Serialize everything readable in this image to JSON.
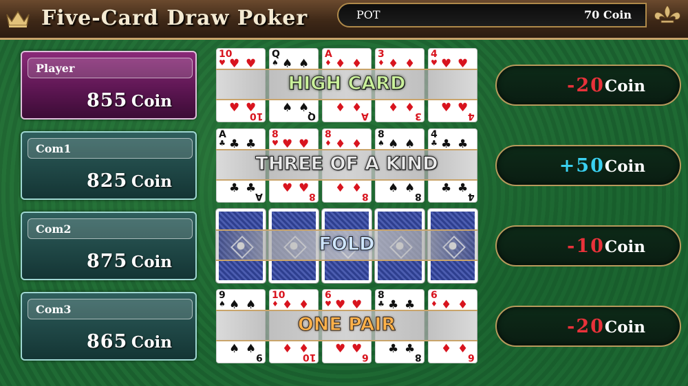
{
  "header": {
    "title": "Five-Card Draw Poker",
    "pot_label": "POT",
    "pot_value": "70 Coin"
  },
  "players": [
    {
      "name": "Player",
      "coins": "855",
      "unit": "Coin"
    },
    {
      "name": "Com1",
      "coins": "825",
      "unit": "Coin"
    },
    {
      "name": "Com2",
      "coins": "875",
      "unit": "Coin"
    },
    {
      "name": "Com3",
      "coins": "865",
      "unit": "Coin"
    }
  ],
  "hands": [
    {
      "result_label": "HIGH CARD",
      "cards": [
        {
          "rank": "10",
          "suit": "♥",
          "color": "red"
        },
        {
          "rank": "Q",
          "suit": "♠",
          "color": "black"
        },
        {
          "rank": "A",
          "suit": "♦",
          "color": "red"
        },
        {
          "rank": "3",
          "suit": "♦",
          "color": "red"
        },
        {
          "rank": "4",
          "suit": "♥",
          "color": "red"
        }
      ]
    },
    {
      "result_label": "THREE OF A KIND",
      "cards": [
        {
          "rank": "A",
          "suit": "♣",
          "color": "black"
        },
        {
          "rank": "8",
          "suit": "♥",
          "color": "red"
        },
        {
          "rank": "8",
          "suit": "♦",
          "color": "red"
        },
        {
          "rank": "8",
          "suit": "♠",
          "color": "black"
        },
        {
          "rank": "4",
          "suit": "♣",
          "color": "black"
        }
      ]
    },
    {
      "result_label": "FOLD",
      "cards": []
    },
    {
      "result_label": "ONE PAIR",
      "cards": [
        {
          "rank": "9",
          "suit": "♠",
          "color": "black"
        },
        {
          "rank": "10",
          "suit": "♦",
          "color": "red"
        },
        {
          "rank": "6",
          "suit": "♥",
          "color": "red"
        },
        {
          "rank": "8",
          "suit": "♣",
          "color": "black"
        },
        {
          "rank": "6",
          "suit": "♦",
          "color": "red"
        }
      ]
    }
  ],
  "results": [
    {
      "delta": "-20",
      "unit": "Coin",
      "sign": "negative"
    },
    {
      "delta": "+50",
      "unit": "Coin",
      "sign": "positive"
    },
    {
      "delta": "-10",
      "unit": "Coin",
      "sign": "negative"
    },
    {
      "delta": "-20",
      "unit": "Coin",
      "sign": "negative"
    }
  ],
  "colors": {
    "negative": "#e8323a",
    "positive": "#3ad0f0",
    "felt": "#1a5f2e",
    "gold_border": "#c9a46a"
  }
}
